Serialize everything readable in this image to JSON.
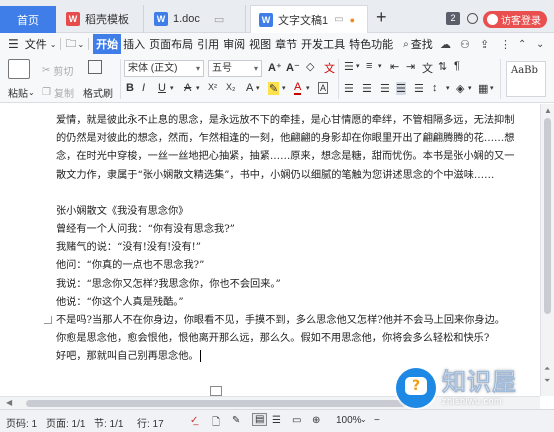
{
  "tabs": {
    "home": "首页",
    "template": "稻壳模板",
    "doc1": "1.doc",
    "active": "文字文稿1",
    "new_tab": "+",
    "page_badge": "2",
    "visitor": "访客登录"
  },
  "menu": {
    "file": "文件",
    "items": [
      "开始",
      "插入",
      "页面布局",
      "引用",
      "审阅",
      "视图",
      "章节",
      "开发工具",
      "特色功能"
    ],
    "search": "查找"
  },
  "ribbon": {
    "paste": "粘贴",
    "cut": "剪切",
    "copy": "复制",
    "format_painter": "格式刷",
    "font_name": "宋体 (正文)",
    "font_size": "五号",
    "bold": "B",
    "italic": "I",
    "underline": "U",
    "font_color_a": "A",
    "grow_font": "A⁺",
    "shrink_font": "A⁻",
    "x2": "X²",
    "x_2": "X₂"
  },
  "document": {
    "paragraphs": [
      "爱情，就是彼此永不止息的思念，是永远放不下的牵挂，是心甘情愿的牵绊，不管相隔多远，无法抑制的仍然是对彼此的想念，然而，乍然相逢的一刻，他翩翩的身影却在你眼里开出了翩翩腾腾的花……想念，在时光中穿梭，一丝一丝地把心抽紧，抽紧……原来，想念是糖，甜而忧伤。本书是张小娴的又一散文力作，隶属于“张小娴散文精选集”，书中，小娴仍以细腻的笔触为您讲述思念的个中滋味……",
      "",
      "张小娴散文《我没有思念你》",
      "曾经有一个人问我：“你有没有思念我?”",
      "我赌气的说：“没有!没有!没有!”",
      "他问：“你真的一点也不思念我?”",
      "我说：“思念你又怎样?我思念你，你也不会回来。”",
      "他说：“你这个人真是残酷。”",
      "不是吗?当那人不在你身边，你眼看不见，手摸不到，多么思念他又怎样?他并不会马上回来你身边。",
      "你愈是思念他，愈会恨他，恨他离开那么远，那么久。假如不用思念他，你将会多么轻松和快乐?",
      "好吧，那就叫自己别再思念他。"
    ]
  },
  "status": {
    "page_num": "页码: 1",
    "pages": "页面: 1/1",
    "section": "节: 1/1",
    "row": "行: 17",
    "zoom": "100%"
  },
  "watermark": {
    "title": "知识屋",
    "subtitle": "zhishiwu.com",
    "bubble_glyph": "?"
  },
  "colors": {
    "accent": "#3f7ee8",
    "visitor": "#e94f4f",
    "wps_red": "#e84b4b",
    "watermark_blue": "#1e88e5"
  }
}
